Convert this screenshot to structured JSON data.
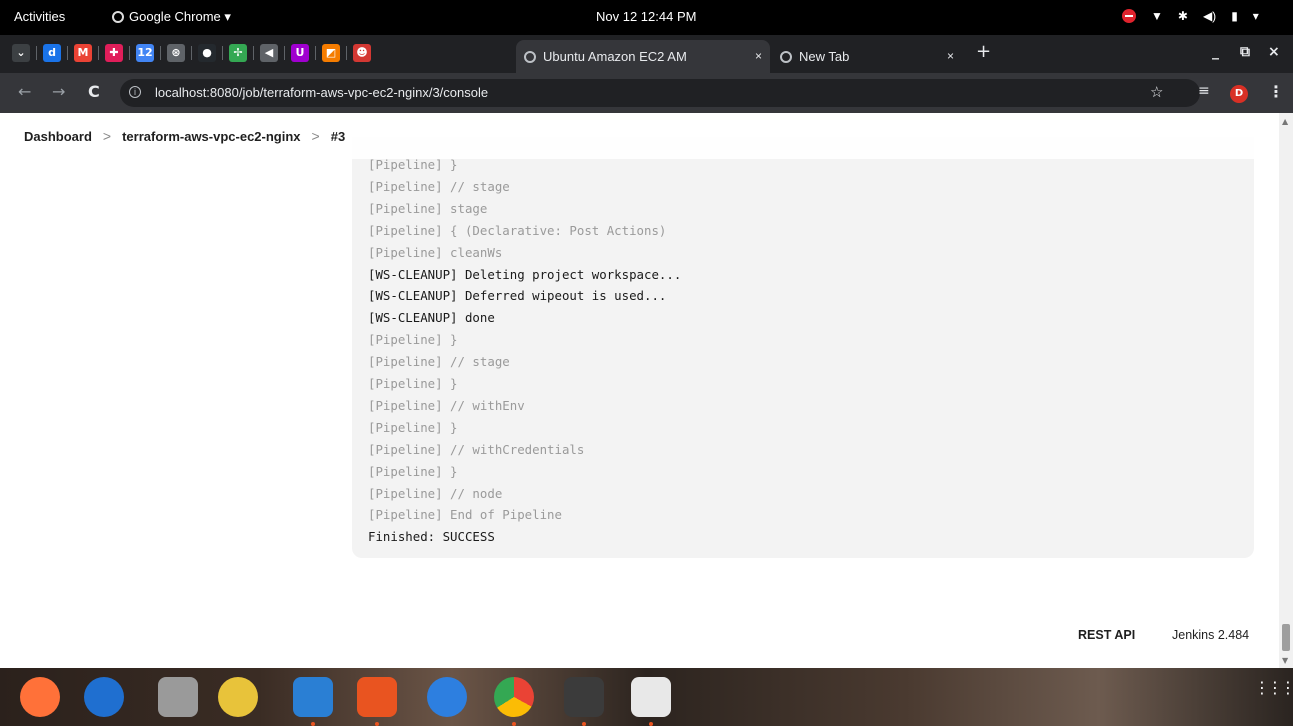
{
  "topbar": {
    "activities": "Activities",
    "app_name": "Google Chrome ▾",
    "clock": "Nov 12  12:44 PM",
    "tray": [
      "▼",
      "✱",
      "◀)",
      "▮",
      "▾"
    ]
  },
  "tabs": {
    "pinned": [
      {
        "icon": "down-chevron-icon",
        "glyph": "⌄",
        "color": "#3c4043"
      },
      {
        "icon": "d-app-icon",
        "glyph": "d",
        "color": "#1a73e8"
      },
      {
        "icon": "gmail-icon",
        "glyph": "M",
        "color": "#ea4335"
      },
      {
        "icon": "slack-icon",
        "glyph": "✚",
        "color": "#e01e5a"
      },
      {
        "icon": "calendar-icon",
        "glyph": "12",
        "color": "#4285f4"
      },
      {
        "icon": "openai-icon",
        "glyph": "⊛",
        "color": "#5f6368"
      },
      {
        "icon": "github-icon",
        "glyph": "●",
        "color": "#24292e"
      },
      {
        "icon": "pinwheel-icon",
        "glyph": "✢",
        "color": "#34a853"
      },
      {
        "icon": "speaker-icon",
        "glyph": "◀",
        "color": "#5f6368"
      },
      {
        "icon": "ublock-icon",
        "glyph": "U",
        "color": "#a000d0"
      },
      {
        "icon": "orange-app-icon",
        "glyph": "◩",
        "color": "#f57c00"
      },
      {
        "icon": "jenkins-icon",
        "glyph": "☻",
        "color": "#d33833"
      }
    ],
    "active_tab": "Ubuntu Amazon EC2 AM",
    "inactive_tab": "New Tab",
    "close": "×",
    "new_tab": "+",
    "minimize": "_",
    "restore": "⧉",
    "close_window": "×"
  },
  "toolbar": {
    "back": "←",
    "forward": "→",
    "reload": "C",
    "url": "localhost:8080/job/terraform-aws-vpc-ec2-nginx/3/console",
    "bookmark": "☆",
    "reading_list": "≡",
    "profile_initial": "D",
    "menu": "⋮"
  },
  "breadcrumbs": {
    "dashboard": "Dashboard",
    "job": "terraform-aws-vpc-ec2-nginx",
    "build": "#3",
    "separator": ">"
  },
  "console": {
    "lines": [
      {
        "text": "[Pipeline] }",
        "muted": true
      },
      {
        "text": "[Pipeline] // stage",
        "muted": true
      },
      {
        "text": "[Pipeline] stage",
        "muted": true
      },
      {
        "text": "[Pipeline] { (Declarative: Post Actions)",
        "muted": true
      },
      {
        "text": "[Pipeline] cleanWs",
        "muted": true
      },
      {
        "text": "[WS-CLEANUP] Deleting project workspace...",
        "muted": false
      },
      {
        "text": "[WS-CLEANUP] Deferred wipeout is used...",
        "muted": false
      },
      {
        "text": "[WS-CLEANUP] done",
        "muted": false
      },
      {
        "text": "[Pipeline] }",
        "muted": true
      },
      {
        "text": "[Pipeline] // stage",
        "muted": true
      },
      {
        "text": "[Pipeline] }",
        "muted": true
      },
      {
        "text": "[Pipeline] // withEnv",
        "muted": true
      },
      {
        "text": "[Pipeline] }",
        "muted": true
      },
      {
        "text": "[Pipeline] // withCredentials",
        "muted": true
      },
      {
        "text": "[Pipeline] }",
        "muted": true
      },
      {
        "text": "[Pipeline] // node",
        "muted": true
      },
      {
        "text": "[Pipeline] End of Pipeline",
        "muted": true
      },
      {
        "text": "Finished: SUCCESS",
        "muted": false
      }
    ]
  },
  "footer": {
    "rest_api": "REST API",
    "version": "Jenkins 2.484"
  },
  "dock": {
    "apps": [
      {
        "name": "firefox-icon",
        "color": "#ff7139",
        "running": false
      },
      {
        "name": "thunderbird-icon",
        "color": "#1f6fd0",
        "running": false
      },
      {
        "name": "files-icon",
        "color": "#9a9a9a",
        "running": false
      },
      {
        "name": "rhythmbox-icon",
        "color": "#e8c33a",
        "running": false
      },
      {
        "name": "libreoffice-writer-icon",
        "color": "#2a7fd4",
        "running": true
      },
      {
        "name": "app-center-icon",
        "color": "#e95420",
        "running": true
      },
      {
        "name": "help-icon",
        "color": "#2d7fe0",
        "running": false
      },
      {
        "name": "chrome-icon",
        "color": "#4285f4",
        "running": true
      },
      {
        "name": "terminal-icon",
        "color": "#3b3b3b",
        "running": true
      },
      {
        "name": "document-viewer-icon",
        "color": "#e8e8e8",
        "running": true
      }
    ],
    "show_apps": "⋮⋮⋮"
  }
}
